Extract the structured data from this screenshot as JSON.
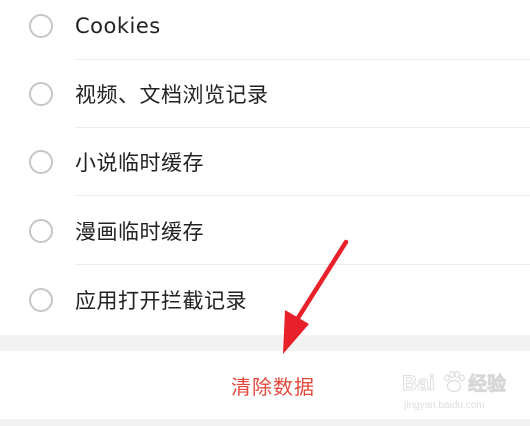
{
  "options": [
    {
      "label": "Cookies",
      "checked": false
    },
    {
      "label": "视频、文档浏览记录",
      "checked": false
    },
    {
      "label": "小说临时缓存",
      "checked": false
    },
    {
      "label": "漫画临时缓存",
      "checked": false
    },
    {
      "label": "应用打开拦截记录",
      "checked": false
    }
  ],
  "action": {
    "label": "清除数据",
    "color": "#e4493b"
  },
  "annotation": {
    "arrow_color": "#e8202a"
  },
  "watermark": {
    "brand": "Baidu",
    "brand_cn": "经验",
    "url": "jingyan.baidu.com"
  }
}
